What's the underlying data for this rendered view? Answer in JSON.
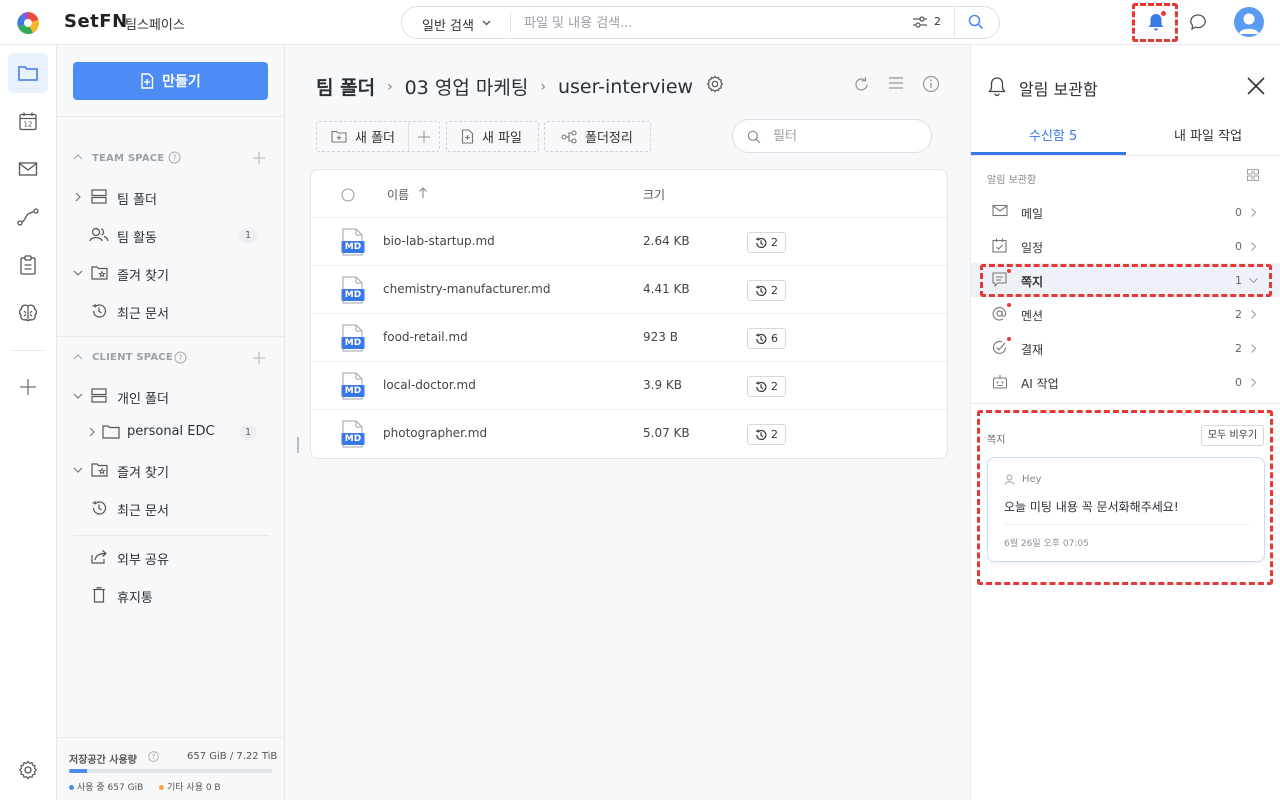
{
  "header": {
    "brand": "SetFN",
    "workspace": "팀스페이스",
    "search_mode": "일반 검색",
    "search_placeholder": "파일 및 내용 검색...",
    "filter_count": "2"
  },
  "sidebar": {
    "create_label": "만들기",
    "team_space_label": "TEAM SPACE",
    "client_space_label": "CLIENT SPACE",
    "team_items": [
      {
        "label": "팀 폴더",
        "icon": "server-icon"
      },
      {
        "label": "팀 활동",
        "icon": "users-icon",
        "badge": "1"
      },
      {
        "label": "즐겨 찾기",
        "icon": "star-folder-icon"
      },
      {
        "label": "최근 문서",
        "icon": "history-icon"
      }
    ],
    "client_items": [
      {
        "label": "개인 폴더",
        "icon": "server-icon"
      },
      {
        "label": "personal EDC",
        "icon": "folder-icon",
        "badge": "1"
      },
      {
        "label": "즐겨 찾기",
        "icon": "star-folder-icon"
      },
      {
        "label": "최근 문서",
        "icon": "history-icon"
      }
    ],
    "extra_items": [
      {
        "label": "외부 공유",
        "icon": "share-icon"
      },
      {
        "label": "휴지통",
        "icon": "trash-icon"
      }
    ],
    "storage": {
      "label": "저장공간 사용량",
      "value": "657 GiB / 7.22 TiB",
      "used_fraction": 0.09,
      "legend_used": "사용 중 657 GiB",
      "legend_other": "기타 사용 0 B",
      "used_color": "#4d8cf5",
      "other_color": "#f5a54d"
    }
  },
  "main": {
    "breadcrumb": [
      "팀 폴더",
      "03 영업 마케팅",
      "user-interview"
    ],
    "toolbar": {
      "new_folder": "새 폴더",
      "new_file": "새 파일",
      "organize": "폴더정리",
      "filter_placeholder": "필터"
    },
    "table": {
      "col_name": "이름",
      "col_size": "크기",
      "rows": [
        {
          "name": "bio-lab-startup.md",
          "size": "2.64 KB",
          "versions": "2"
        },
        {
          "name": "chemistry-manufacturer.md",
          "size": "4.41 KB",
          "versions": "2"
        },
        {
          "name": "food-retail.md",
          "size": "923 B",
          "versions": "6"
        },
        {
          "name": "local-doctor.md",
          "size": "3.9 KB",
          "versions": "2"
        },
        {
          "name": "photographer.md",
          "size": "5.07 KB",
          "versions": "2"
        }
      ],
      "file_badge": "MD"
    }
  },
  "notifications": {
    "title": "알림 보관함",
    "tabs": [
      "수신함 5",
      "내 파일 작업"
    ],
    "section_label": "알림 보관함",
    "categories": [
      {
        "label": "메일",
        "count": "0",
        "icon": "mail-icon"
      },
      {
        "label": "일정",
        "count": "0",
        "icon": "calendar-check-icon"
      },
      {
        "label": "쪽지",
        "count": "1",
        "icon": "memo-icon"
      },
      {
        "label": "멘션",
        "count": "2",
        "icon": "at-icon"
      },
      {
        "label": "결재",
        "count": "2",
        "icon": "approval-icon"
      },
      {
        "label": "AI 작업",
        "count": "0",
        "icon": "robot-icon"
      }
    ],
    "memo_section_label": "쪽지",
    "clear_all": "모두 비우기",
    "memo": {
      "sender": "Hey",
      "message": "오늘 미팅 내용 꼭 문서화해주세요!",
      "time": "6월 26일 오후 07:05"
    }
  },
  "colors": {
    "accent": "#4d8cf5",
    "highlight_dash": "#e53935"
  }
}
